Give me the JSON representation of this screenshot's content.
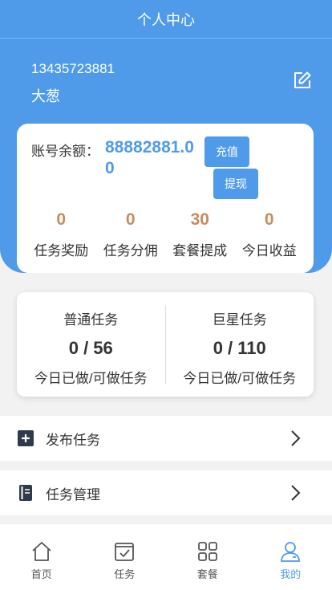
{
  "header": {
    "title": "个人中心"
  },
  "profile": {
    "phone": "13435723881",
    "nickname": "大葱"
  },
  "balance": {
    "label": "账号余额：",
    "value": "88882881.00",
    "recharge_label": "充值",
    "withdraw_label": "提现"
  },
  "stats": [
    {
      "value": "0",
      "label": "任务奖励"
    },
    {
      "value": "0",
      "label": "任务分佣"
    },
    {
      "value": "30",
      "label": "套餐提成"
    },
    {
      "value": "0",
      "label": "今日收益"
    }
  ],
  "tasks": [
    {
      "title": "普通任务",
      "count": "0 / 56",
      "sub": "今日已做/可做任务"
    },
    {
      "title": "巨星任务",
      "count": "0 / 110",
      "sub": "今日已做/可做任务"
    }
  ],
  "menu": [
    {
      "label": "发布任务",
      "icon": "plus-square-icon"
    },
    {
      "label": "任务管理",
      "icon": "document-icon"
    }
  ],
  "tabbar": [
    {
      "label": "首页",
      "icon": "home-icon",
      "active": false
    },
    {
      "label": "任务",
      "icon": "task-check-icon",
      "active": false
    },
    {
      "label": "套餐",
      "icon": "grid-icon",
      "active": false
    },
    {
      "label": "我的",
      "icon": "user-icon",
      "active": true
    }
  ],
  "colors": {
    "primary": "#4f9bea",
    "stat_number": "#c98b5e",
    "background": "#f2f2f2"
  }
}
